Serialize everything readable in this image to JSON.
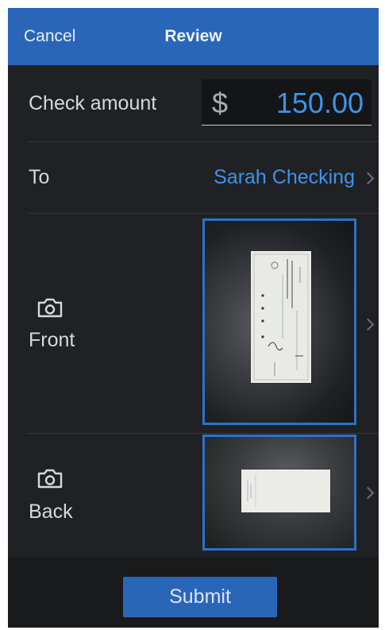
{
  "header": {
    "cancel_label": "Cancel",
    "title": "Review"
  },
  "amount": {
    "label": "Check amount",
    "currency_symbol": "$",
    "value": "150.00"
  },
  "to": {
    "label": "To",
    "account": "Sarah Checking"
  },
  "front": {
    "label": "Front"
  },
  "back": {
    "label": "Back"
  },
  "footer": {
    "submit_label": "Submit"
  },
  "colors": {
    "header_bg": "#2a66b8",
    "accent_blue": "#3f93ea",
    "body_bg": "#1f2124",
    "thumbnail_border": "#2c72c9"
  },
  "icons": {
    "front_icon": "camera-icon",
    "back_icon": "camera-icon",
    "row_chevron": "chevron-right-icon"
  }
}
